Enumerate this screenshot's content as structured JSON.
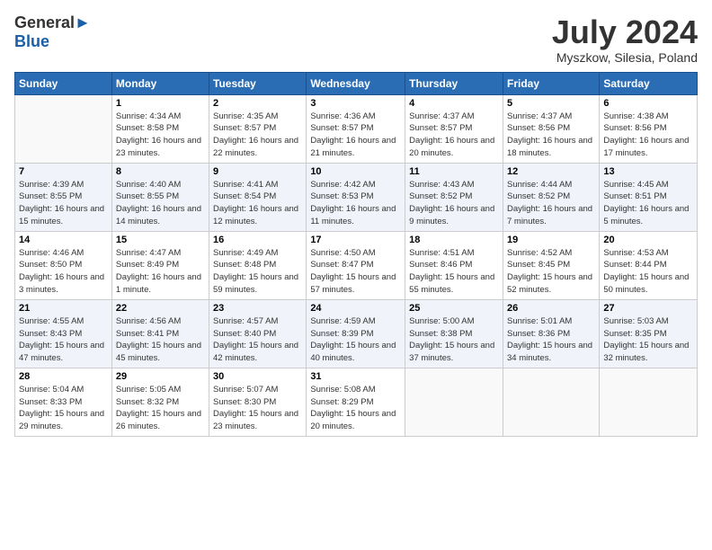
{
  "header": {
    "logo_line1": "General",
    "logo_line2": "Blue",
    "month": "July 2024",
    "location": "Myszkow, Silesia, Poland"
  },
  "days_of_week": [
    "Sunday",
    "Monday",
    "Tuesday",
    "Wednesday",
    "Thursday",
    "Friday",
    "Saturday"
  ],
  "weeks": [
    [
      {
        "day": "",
        "sunrise": "",
        "sunset": "",
        "daylight": ""
      },
      {
        "day": "1",
        "sunrise": "Sunrise: 4:34 AM",
        "sunset": "Sunset: 8:58 PM",
        "daylight": "Daylight: 16 hours and 23 minutes."
      },
      {
        "day": "2",
        "sunrise": "Sunrise: 4:35 AM",
        "sunset": "Sunset: 8:57 PM",
        "daylight": "Daylight: 16 hours and 22 minutes."
      },
      {
        "day": "3",
        "sunrise": "Sunrise: 4:36 AM",
        "sunset": "Sunset: 8:57 PM",
        "daylight": "Daylight: 16 hours and 21 minutes."
      },
      {
        "day": "4",
        "sunrise": "Sunrise: 4:37 AM",
        "sunset": "Sunset: 8:57 PM",
        "daylight": "Daylight: 16 hours and 20 minutes."
      },
      {
        "day": "5",
        "sunrise": "Sunrise: 4:37 AM",
        "sunset": "Sunset: 8:56 PM",
        "daylight": "Daylight: 16 hours and 18 minutes."
      },
      {
        "day": "6",
        "sunrise": "Sunrise: 4:38 AM",
        "sunset": "Sunset: 8:56 PM",
        "daylight": "Daylight: 16 hours and 17 minutes."
      }
    ],
    [
      {
        "day": "7",
        "sunrise": "Sunrise: 4:39 AM",
        "sunset": "Sunset: 8:55 PM",
        "daylight": "Daylight: 16 hours and 15 minutes."
      },
      {
        "day": "8",
        "sunrise": "Sunrise: 4:40 AM",
        "sunset": "Sunset: 8:55 PM",
        "daylight": "Daylight: 16 hours and 14 minutes."
      },
      {
        "day": "9",
        "sunrise": "Sunrise: 4:41 AM",
        "sunset": "Sunset: 8:54 PM",
        "daylight": "Daylight: 16 hours and 12 minutes."
      },
      {
        "day": "10",
        "sunrise": "Sunrise: 4:42 AM",
        "sunset": "Sunset: 8:53 PM",
        "daylight": "Daylight: 16 hours and 11 minutes."
      },
      {
        "day": "11",
        "sunrise": "Sunrise: 4:43 AM",
        "sunset": "Sunset: 8:52 PM",
        "daylight": "Daylight: 16 hours and 9 minutes."
      },
      {
        "day": "12",
        "sunrise": "Sunrise: 4:44 AM",
        "sunset": "Sunset: 8:52 PM",
        "daylight": "Daylight: 16 hours and 7 minutes."
      },
      {
        "day": "13",
        "sunrise": "Sunrise: 4:45 AM",
        "sunset": "Sunset: 8:51 PM",
        "daylight": "Daylight: 16 hours and 5 minutes."
      }
    ],
    [
      {
        "day": "14",
        "sunrise": "Sunrise: 4:46 AM",
        "sunset": "Sunset: 8:50 PM",
        "daylight": "Daylight: 16 hours and 3 minutes."
      },
      {
        "day": "15",
        "sunrise": "Sunrise: 4:47 AM",
        "sunset": "Sunset: 8:49 PM",
        "daylight": "Daylight: 16 hours and 1 minute."
      },
      {
        "day": "16",
        "sunrise": "Sunrise: 4:49 AM",
        "sunset": "Sunset: 8:48 PM",
        "daylight": "Daylight: 15 hours and 59 minutes."
      },
      {
        "day": "17",
        "sunrise": "Sunrise: 4:50 AM",
        "sunset": "Sunset: 8:47 PM",
        "daylight": "Daylight: 15 hours and 57 minutes."
      },
      {
        "day": "18",
        "sunrise": "Sunrise: 4:51 AM",
        "sunset": "Sunset: 8:46 PM",
        "daylight": "Daylight: 15 hours and 55 minutes."
      },
      {
        "day": "19",
        "sunrise": "Sunrise: 4:52 AM",
        "sunset": "Sunset: 8:45 PM",
        "daylight": "Daylight: 15 hours and 52 minutes."
      },
      {
        "day": "20",
        "sunrise": "Sunrise: 4:53 AM",
        "sunset": "Sunset: 8:44 PM",
        "daylight": "Daylight: 15 hours and 50 minutes."
      }
    ],
    [
      {
        "day": "21",
        "sunrise": "Sunrise: 4:55 AM",
        "sunset": "Sunset: 8:43 PM",
        "daylight": "Daylight: 15 hours and 47 minutes."
      },
      {
        "day": "22",
        "sunrise": "Sunrise: 4:56 AM",
        "sunset": "Sunset: 8:41 PM",
        "daylight": "Daylight: 15 hours and 45 minutes."
      },
      {
        "day": "23",
        "sunrise": "Sunrise: 4:57 AM",
        "sunset": "Sunset: 8:40 PM",
        "daylight": "Daylight: 15 hours and 42 minutes."
      },
      {
        "day": "24",
        "sunrise": "Sunrise: 4:59 AM",
        "sunset": "Sunset: 8:39 PM",
        "daylight": "Daylight: 15 hours and 40 minutes."
      },
      {
        "day": "25",
        "sunrise": "Sunrise: 5:00 AM",
        "sunset": "Sunset: 8:38 PM",
        "daylight": "Daylight: 15 hours and 37 minutes."
      },
      {
        "day": "26",
        "sunrise": "Sunrise: 5:01 AM",
        "sunset": "Sunset: 8:36 PM",
        "daylight": "Daylight: 15 hours and 34 minutes."
      },
      {
        "day": "27",
        "sunrise": "Sunrise: 5:03 AM",
        "sunset": "Sunset: 8:35 PM",
        "daylight": "Daylight: 15 hours and 32 minutes."
      }
    ],
    [
      {
        "day": "28",
        "sunrise": "Sunrise: 5:04 AM",
        "sunset": "Sunset: 8:33 PM",
        "daylight": "Daylight: 15 hours and 29 minutes."
      },
      {
        "day": "29",
        "sunrise": "Sunrise: 5:05 AM",
        "sunset": "Sunset: 8:32 PM",
        "daylight": "Daylight: 15 hours and 26 minutes."
      },
      {
        "day": "30",
        "sunrise": "Sunrise: 5:07 AM",
        "sunset": "Sunset: 8:30 PM",
        "daylight": "Daylight: 15 hours and 23 minutes."
      },
      {
        "day": "31",
        "sunrise": "Sunrise: 5:08 AM",
        "sunset": "Sunset: 8:29 PM",
        "daylight": "Daylight: 15 hours and 20 minutes."
      },
      {
        "day": "",
        "sunrise": "",
        "sunset": "",
        "daylight": ""
      },
      {
        "day": "",
        "sunrise": "",
        "sunset": "",
        "daylight": ""
      },
      {
        "day": "",
        "sunrise": "",
        "sunset": "",
        "daylight": ""
      }
    ]
  ]
}
